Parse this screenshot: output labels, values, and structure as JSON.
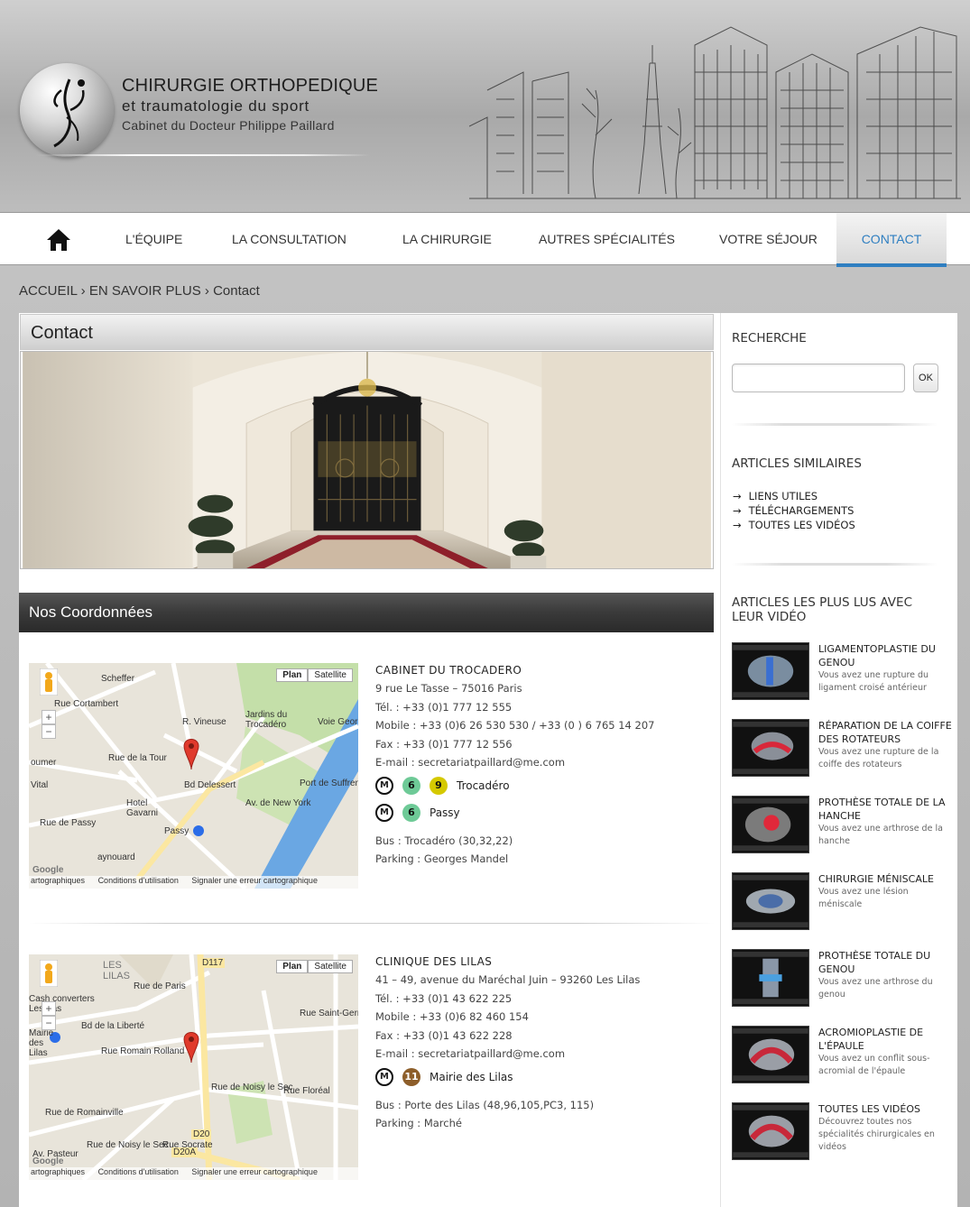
{
  "header": {
    "title": "CHIRURGIE ORTHOPEDIQUE",
    "subtitle": "et traumatologie du sport",
    "tagline": "Cabinet du Docteur Philippe Paillard"
  },
  "nav": {
    "home_icon": "home-icon",
    "items": [
      "L'ÉQUIPE",
      "LA CONSULTATION",
      "LA CHIRURGIE",
      "AUTRES SPÉCIALITÉS",
      "VOTRE SÉJOUR",
      "CONTACT"
    ],
    "active": "CONTACT",
    "accent_color": "#2f7fc1"
  },
  "breadcrumb": {
    "home": "ACCUEIL",
    "sep1": "›",
    "parent": "EN SAVOIR PLUS",
    "sep2": "›",
    "current": "Contact"
  },
  "page": {
    "title": "Contact",
    "section_title": "Nos Coordonnées"
  },
  "map": {
    "plan_label": "Plan",
    "satellite_label": "Satellite",
    "zoom_in": "+",
    "zoom_out": "−",
    "footer_data": "artographiques",
    "footer_terms": "Conditions d'utilisation",
    "footer_report": "Signaler une erreur cartographique",
    "footer_data_2": "artographiques"
  },
  "map1_labels": {
    "scheffer": "Scheffer",
    "cortambert": "Rue Cortambert",
    "jardins": "Jardins du Trocadéro",
    "vineuse": "R. Vineuse",
    "tour": "Rue de la Tour",
    "delessert": "Bd Delessert",
    "passy_rue": "Rue de Passy",
    "hotel": "Hotel Gavarni",
    "passy": "Passy",
    "newyork": "Av. de New York",
    "voie": "Voie Georges",
    "suffren": "Port de Suffren",
    "oumer": "oumer",
    "vital": "Vital",
    "raynouard": "aynouard",
    "google": "Google"
  },
  "map2_labels": {
    "les_lilas": "LES LILAS",
    "d117": "D117",
    "paris": "Rue de Paris",
    "cash": "Cash converters Les lilas",
    "liberte": "Bd de la Liberté",
    "mairie": "Mairie des Lilas",
    "rolland": "Rue Romain Rolland",
    "noisy": "Rue de Noisy le Sec",
    "floreal": "Rue Floréal",
    "romainville": "Rue de Romainville",
    "noisy2": "Rue de Noisy le Sec",
    "socrate": "Rue Socrate",
    "d20": "D20",
    "d20a": "D20A",
    "pasteur": "Av. Pasteur",
    "saint": "Rue Saint-Germain",
    "google": "Google"
  },
  "locations": [
    {
      "name": "CABINET DU TROCADERO",
      "address": "9 rue Le Tasse – 75016 Paris",
      "tel": "Tél. : +33 (0)1 777 12 555",
      "mobile": "Mobile : +33 (0)6 26 530 530 / +33 (0 ) 6 765 14 207",
      "fax": "Fax : +33 (0)1 777 12 556",
      "email": "E-mail : secretariatpaillard@me.com",
      "metro": [
        {
          "m": "M",
          "lines": [
            {
              "n": "6",
              "color": "#6eca97"
            },
            {
              "n": "9",
              "color": "#d5c900"
            }
          ],
          "station": "Trocadéro"
        },
        {
          "m": "M",
          "lines": [
            {
              "n": "6",
              "color": "#6eca97"
            }
          ],
          "station": "Passy"
        }
      ],
      "bus": "Bus : Trocadéro (30,32,22)",
      "parking": "Parking : Georges Mandel"
    },
    {
      "name": "CLINIQUE DES LILAS",
      "address": "41 – 49, avenue du Maréchal Juin – 93260 Les Lilas",
      "tel": "Tél. : +33 (0)1 43 622 225",
      "mobile": "Mobile : +33 (0)6 82 460 154",
      "fax": "Fax : +33 (0)1 43 622 228",
      "email": "E-mail : secretariatpaillard@me.com",
      "metro": [
        {
          "m": "M",
          "lines": [
            {
              "n": "11",
              "color": "#8d5e2a"
            }
          ],
          "station": "Mairie des Lilas"
        }
      ],
      "bus": "Bus : Porte des Lilas (48,96,105,PC3, 115)",
      "parking": "Parking : Marché"
    }
  ],
  "sidebar": {
    "search_heading": "RECHERCHE",
    "search_value": "",
    "search_button": "OK",
    "similar_heading": "ARTICLES SIMILAIRES",
    "similar": [
      "LIENS UTILES",
      "TÉLÉCHARGEMENTS",
      "TOUTES LES VIDÉOS"
    ],
    "popular_heading": "ARTICLES LES PLUS LUS AVEC LEUR VIDÉO",
    "articles": [
      {
        "title": "LIGAMENTOPLASTIE DU GENOU",
        "desc": "Vous avez une rupture du ligament croisé antérieur"
      },
      {
        "title": "RÉPARATION DE LA COIFFE DES ROTATEURS",
        "desc": "Vous avez une rupture de la coiffe des rotateurs"
      },
      {
        "title": "PROTHÈSE TOTALE DE LA HANCHE",
        "desc": "Vous avez une arthrose de la hanche"
      },
      {
        "title": "CHIRURGIE MÉNISCALE",
        "desc": "Vous avez une lésion méniscale"
      },
      {
        "title": "PROTHÈSE TOTALE DU GENOU",
        "desc": "Vous avez une arthrose du genou"
      },
      {
        "title": "ACROMIOPLASTIE DE L'ÉPAULE",
        "desc": "Vous avez un conflit sous-acromial de l'épaule"
      },
      {
        "title": "TOUTES LES VIDÉOS",
        "desc": "Découvrez toutes nos spécialités chirurgicales en vidéos"
      }
    ]
  }
}
